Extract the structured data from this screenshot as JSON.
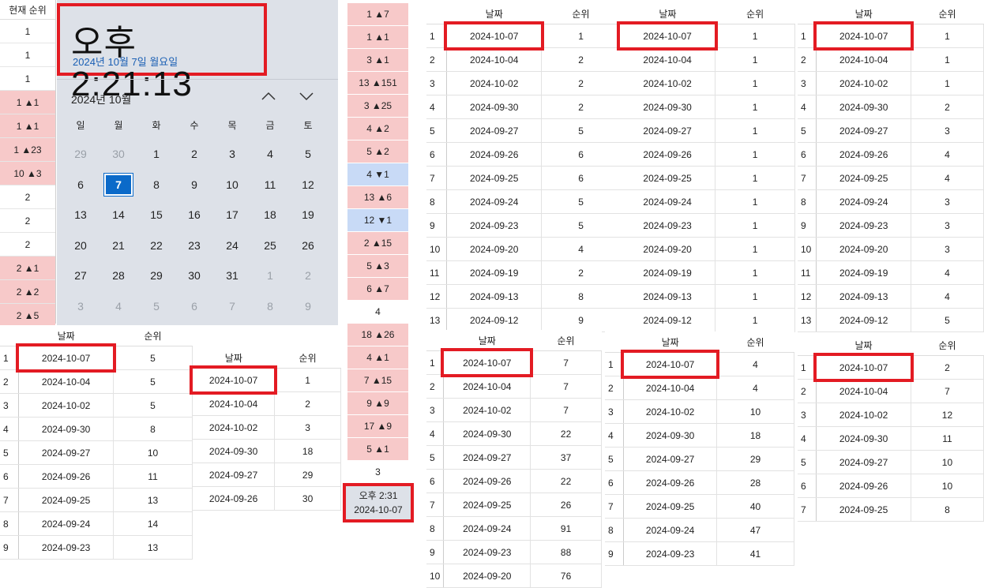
{
  "left_column": {
    "header": "현재 순위",
    "cells": [
      {
        "text": "1",
        "bg": "white"
      },
      {
        "text": "1",
        "bg": "white"
      },
      {
        "text": "1",
        "bg": "white"
      },
      {
        "text": "1 ▲1",
        "bg": "pink"
      },
      {
        "text": "1 ▲1",
        "bg": "pink"
      },
      {
        "text": "1 ▲23",
        "bg": "pink"
      },
      {
        "text": "10 ▲3",
        "bg": "pink"
      },
      {
        "text": "2",
        "bg": "white"
      },
      {
        "text": "2",
        "bg": "white"
      },
      {
        "text": "2",
        "bg": "white"
      },
      {
        "text": "2 ▲1",
        "bg": "pink"
      },
      {
        "text": "2 ▲2",
        "bg": "pink"
      },
      {
        "text": "2 ▲5",
        "bg": "pink"
      }
    ]
  },
  "clock": {
    "time": "오후 2:21:13",
    "date": "2024년 10월 7일 월요일",
    "month_label": "2024년 10월",
    "up_icon": "chevron-up-icon",
    "down_icon": "chevron-down-icon",
    "weekdays": [
      "일",
      "월",
      "화",
      "수",
      "목",
      "금",
      "토"
    ],
    "days": [
      {
        "d": "29",
        "dim": true
      },
      {
        "d": "30",
        "dim": true
      },
      {
        "d": "1"
      },
      {
        "d": "2"
      },
      {
        "d": "3"
      },
      {
        "d": "4"
      },
      {
        "d": "5"
      },
      {
        "d": "6"
      },
      {
        "d": "7",
        "today": true
      },
      {
        "d": "8"
      },
      {
        "d": "9"
      },
      {
        "d": "10"
      },
      {
        "d": "11"
      },
      {
        "d": "12"
      },
      {
        "d": "13"
      },
      {
        "d": "14"
      },
      {
        "d": "15"
      },
      {
        "d": "16"
      },
      {
        "d": "17"
      },
      {
        "d": "18"
      },
      {
        "d": "19"
      },
      {
        "d": "20"
      },
      {
        "d": "21"
      },
      {
        "d": "22"
      },
      {
        "d": "23"
      },
      {
        "d": "24"
      },
      {
        "d": "25"
      },
      {
        "d": "26"
      },
      {
        "d": "27"
      },
      {
        "d": "28"
      },
      {
        "d": "29"
      },
      {
        "d": "30"
      },
      {
        "d": "31"
      },
      {
        "d": "1",
        "dim": true
      },
      {
        "d": "2",
        "dim": true
      },
      {
        "d": "3",
        "dim": true
      },
      {
        "d": "4",
        "dim": true
      },
      {
        "d": "5",
        "dim": true
      },
      {
        "d": "6",
        "dim": true
      },
      {
        "d": "7",
        "dim": true
      },
      {
        "d": "8",
        "dim": true
      },
      {
        "d": "9",
        "dim": true
      }
    ]
  },
  "middle_column": {
    "cells": [
      {
        "text": "1 ▲7",
        "bg": "pink"
      },
      {
        "text": "1 ▲1",
        "bg": "pink"
      },
      {
        "text": "3 ▲1",
        "bg": "pink"
      },
      {
        "text": "13 ▲151",
        "bg": "pink"
      },
      {
        "text": "3 ▲25",
        "bg": "pink"
      },
      {
        "text": "4 ▲2",
        "bg": "pink"
      },
      {
        "text": "5 ▲2",
        "bg": "pink"
      },
      {
        "text": "4 ▼1",
        "bg": "blue"
      },
      {
        "text": "13 ▲6",
        "bg": "pink"
      },
      {
        "text": "12 ▼1",
        "bg": "blue"
      },
      {
        "text": "2 ▲15",
        "bg": "pink"
      },
      {
        "text": "5 ▲3",
        "bg": "pink"
      },
      {
        "text": "6 ▲7",
        "bg": "pink"
      },
      {
        "text": "4",
        "bg": "white"
      },
      {
        "text": "18 ▲26",
        "bg": "pink"
      },
      {
        "text": "4 ▲1",
        "bg": "pink"
      },
      {
        "text": "7 ▲15",
        "bg": "pink"
      },
      {
        "text": "9 ▲9",
        "bg": "pink"
      },
      {
        "text": "17 ▲9",
        "bg": "pink"
      },
      {
        "text": "5 ▲1",
        "bg": "pink"
      },
      {
        "text": "3",
        "bg": "white"
      }
    ],
    "time_box": {
      "line1": "오후 2:31",
      "line2": "2024-10-07"
    }
  },
  "tables": [
    {
      "id": "t1",
      "headers": [
        "날짜",
        "순위"
      ],
      "rows": [
        [
          "1",
          "2024-10-07",
          "1"
        ],
        [
          "2",
          "2024-10-04",
          "2"
        ],
        [
          "3",
          "2024-10-02",
          "2"
        ],
        [
          "4",
          "2024-09-30",
          "2"
        ],
        [
          "5",
          "2024-09-27",
          "5"
        ],
        [
          "6",
          "2024-09-26",
          "6"
        ],
        [
          "7",
          "2024-09-25",
          "6"
        ],
        [
          "8",
          "2024-09-24",
          "5"
        ],
        [
          "9",
          "2024-09-23",
          "5"
        ],
        [
          "10",
          "2024-09-20",
          "4"
        ],
        [
          "11",
          "2024-09-19",
          "2"
        ],
        [
          "12",
          "2024-09-13",
          "8"
        ],
        [
          "13",
          "2024-09-12",
          "9"
        ]
      ]
    },
    {
      "id": "t2",
      "headers": [
        "날짜",
        "순위"
      ],
      "rows": [
        [
          "",
          "2024-10-07",
          "1"
        ],
        [
          "",
          "2024-10-04",
          "1"
        ],
        [
          "",
          "2024-10-02",
          "1"
        ],
        [
          "",
          "2024-09-30",
          "1"
        ],
        [
          "",
          "2024-09-27",
          "1"
        ],
        [
          "",
          "2024-09-26",
          "1"
        ],
        [
          "",
          "2024-09-25",
          "1"
        ],
        [
          "",
          "2024-09-24",
          "1"
        ],
        [
          "",
          "2024-09-23",
          "1"
        ],
        [
          "",
          "2024-09-20",
          "1"
        ],
        [
          "",
          "2024-09-19",
          "1"
        ],
        [
          "",
          "2024-09-13",
          "1"
        ],
        [
          "",
          "2024-09-12",
          "1"
        ]
      ]
    },
    {
      "id": "t3",
      "headers": [
        "날짜",
        "순위"
      ],
      "rows": [
        [
          "1",
          "2024-10-07",
          "1"
        ],
        [
          "2",
          "2024-10-04",
          "1"
        ],
        [
          "3",
          "2024-10-02",
          "1"
        ],
        [
          "4",
          "2024-09-30",
          "2"
        ],
        [
          "5",
          "2024-09-27",
          "3"
        ],
        [
          "6",
          "2024-09-26",
          "4"
        ],
        [
          "7",
          "2024-09-25",
          "4"
        ],
        [
          "8",
          "2024-09-24",
          "3"
        ],
        [
          "9",
          "2024-09-23",
          "3"
        ],
        [
          "10",
          "2024-09-20",
          "3"
        ],
        [
          "11",
          "2024-09-19",
          "4"
        ],
        [
          "12",
          "2024-09-13",
          "4"
        ],
        [
          "13",
          "2024-09-12",
          "5"
        ]
      ]
    },
    {
      "id": "t4",
      "headers": [
        "날짜",
        "순위"
      ],
      "rows": [
        [
          "1",
          "2024-10-07",
          "5"
        ],
        [
          "2",
          "2024-10-04",
          "5"
        ],
        [
          "3",
          "2024-10-02",
          "5"
        ],
        [
          "4",
          "2024-09-30",
          "8"
        ],
        [
          "5",
          "2024-09-27",
          "10"
        ],
        [
          "6",
          "2024-09-26",
          "11"
        ],
        [
          "7",
          "2024-09-25",
          "13"
        ],
        [
          "8",
          "2024-09-24",
          "14"
        ],
        [
          "9",
          "2024-09-23",
          "13"
        ]
      ]
    },
    {
      "id": "t5",
      "headers": [
        "날짜",
        "순위"
      ],
      "rows": [
        [
          "",
          "2024-10-07",
          "1"
        ],
        [
          "",
          "2024-10-04",
          "2"
        ],
        [
          "",
          "2024-10-02",
          "3"
        ],
        [
          "",
          "2024-09-30",
          "18"
        ],
        [
          "",
          "2024-09-27",
          "29"
        ],
        [
          "",
          "2024-09-26",
          "30"
        ]
      ]
    },
    {
      "id": "t6",
      "headers": [
        "날짜",
        "순위"
      ],
      "rows": [
        [
          "1",
          "2024-10-07",
          "7"
        ],
        [
          "2",
          "2024-10-04",
          "7"
        ],
        [
          "3",
          "2024-10-02",
          "7"
        ],
        [
          "4",
          "2024-09-30",
          "22"
        ],
        [
          "5",
          "2024-09-27",
          "37"
        ],
        [
          "6",
          "2024-09-26",
          "22"
        ],
        [
          "7",
          "2024-09-25",
          "26"
        ],
        [
          "8",
          "2024-09-24",
          "91"
        ],
        [
          "9",
          "2024-09-23",
          "88"
        ],
        [
          "10",
          "2024-09-20",
          "76"
        ]
      ]
    },
    {
      "id": "t7",
      "headers": [
        "날짜",
        "순위"
      ],
      "rows": [
        [
          "1",
          "2024-10-07",
          "4"
        ],
        [
          "2",
          "2024-10-04",
          "4"
        ],
        [
          "3",
          "2024-10-02",
          "10"
        ],
        [
          "4",
          "2024-09-30",
          "18"
        ],
        [
          "5",
          "2024-09-27",
          "29"
        ],
        [
          "6",
          "2024-09-26",
          "28"
        ],
        [
          "7",
          "2024-09-25",
          "40"
        ],
        [
          "8",
          "2024-09-24",
          "47"
        ],
        [
          "9",
          "2024-09-23",
          "41"
        ]
      ]
    },
    {
      "id": "t8",
      "headers": [
        "날짜",
        "순위"
      ],
      "rows": [
        [
          "1",
          "2024-10-07",
          "2"
        ],
        [
          "2",
          "2024-10-04",
          "7"
        ],
        [
          "3",
          "2024-10-02",
          "12"
        ],
        [
          "4",
          "2024-09-30",
          "11"
        ],
        [
          "5",
          "2024-09-27",
          "10"
        ],
        [
          "6",
          "2024-09-26",
          "10"
        ],
        [
          "7",
          "2024-09-25",
          "8"
        ]
      ]
    }
  ]
}
